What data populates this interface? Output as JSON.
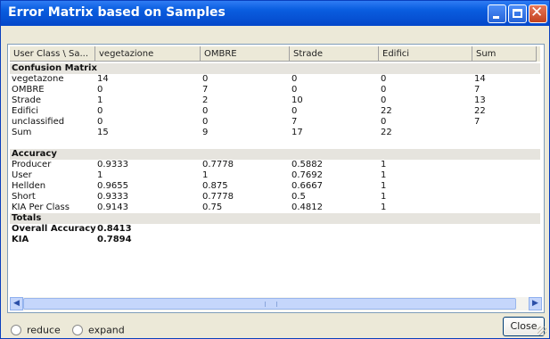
{
  "window": {
    "title": "Error Matrix based on Samples"
  },
  "table": {
    "columns": [
      "User Class \\ Sa...",
      "vegetazione",
      "OMBRE",
      "Strade",
      "Edifici",
      "Sum"
    ],
    "confusion_title": "Confusion Matrix",
    "confusion_rows": [
      [
        "vegetazone",
        "14",
        "0",
        "0",
        "0",
        "14"
      ],
      [
        "OMBRE",
        "0",
        "7",
        "0",
        "0",
        "7"
      ],
      [
        "Strade",
        "1",
        "2",
        "10",
        "0",
        "13"
      ],
      [
        "Edifici",
        "0",
        "0",
        "0",
        "22",
        "22"
      ],
      [
        "unclassified",
        "0",
        "0",
        "7",
        "0",
        "7"
      ],
      [
        "Sum",
        "15",
        "9",
        "17",
        "22",
        ""
      ]
    ],
    "accuracy_title": "Accuracy",
    "accuracy_rows": [
      [
        "Producer",
        "0.9333",
        "0.7778",
        "0.5882",
        "1",
        ""
      ],
      [
        "User",
        "1",
        "1",
        "0.7692",
        "1",
        ""
      ],
      [
        "Hellden",
        "0.9655",
        "0.875",
        "0.6667",
        "1",
        ""
      ],
      [
        "Short",
        "0.9333",
        "0.7778",
        "0.5",
        "1",
        ""
      ],
      [
        "KIA Per Class",
        "0.9143",
        "0.75",
        "0.4812",
        "1",
        ""
      ]
    ],
    "totals_title": "Totals",
    "totals_rows": [
      [
        "Overall Accuracy",
        "0.8413"
      ],
      [
        "KIA",
        "0.7894"
      ]
    ]
  },
  "options": {
    "reduce_label": "reduce",
    "expand_label": "expand"
  },
  "buttons": {
    "close_label": "Close"
  }
}
